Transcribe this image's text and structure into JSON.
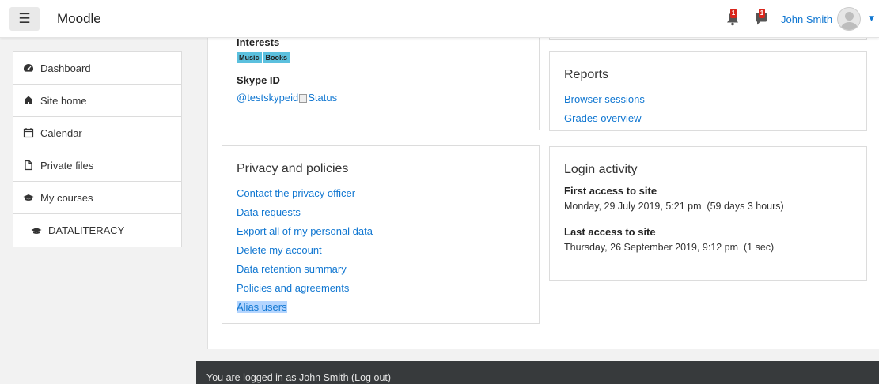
{
  "navbar": {
    "brand": "Moodle",
    "user_name": "John Smith",
    "notification_count": "1",
    "message_count": "1"
  },
  "drawer": {
    "items": [
      {
        "label": "Dashboard",
        "icon": "dashboard-icon"
      },
      {
        "label": "Site home",
        "icon": "home-icon"
      },
      {
        "label": "Calendar",
        "icon": "calendar-icon"
      },
      {
        "label": "Private files",
        "icon": "file-icon"
      },
      {
        "label": "My courses",
        "icon": "graduation-cap-icon"
      },
      {
        "label": "DATALITERACY",
        "icon": "graduation-cap-icon"
      }
    ]
  },
  "profile": {
    "interests_label": "Interests",
    "interests": [
      "Music",
      "Books"
    ],
    "skype_label": "Skype ID",
    "skype_id": "@testskypeid",
    "skype_status_alt": "Status"
  },
  "privacy": {
    "title": "Privacy and policies",
    "links": [
      "Contact the privacy officer",
      "Data requests",
      "Export all of my personal data",
      "Delete my account",
      "Data retention summary",
      "Policies and agreements",
      "Alias users"
    ]
  },
  "reports": {
    "title": "Reports",
    "links": [
      "Browser sessions",
      "Grades overview"
    ]
  },
  "login_activity": {
    "title": "Login activity",
    "first_access_label": "First access to site",
    "first_access_value": "Monday, 29 July 2019, 5:21 pm  (59 days 3 hours)",
    "last_access_label": "Last access to site",
    "last_access_value": "Thursday, 26 September 2019, 9:12 pm  (1 sec)"
  },
  "footer": {
    "logged_in_text": "You are logged in as John Smith (Log out)"
  },
  "colors": {
    "link": "#1177d1",
    "tag": "#5bc0de",
    "badge": "#d9261c",
    "footer": "#373a3c"
  }
}
